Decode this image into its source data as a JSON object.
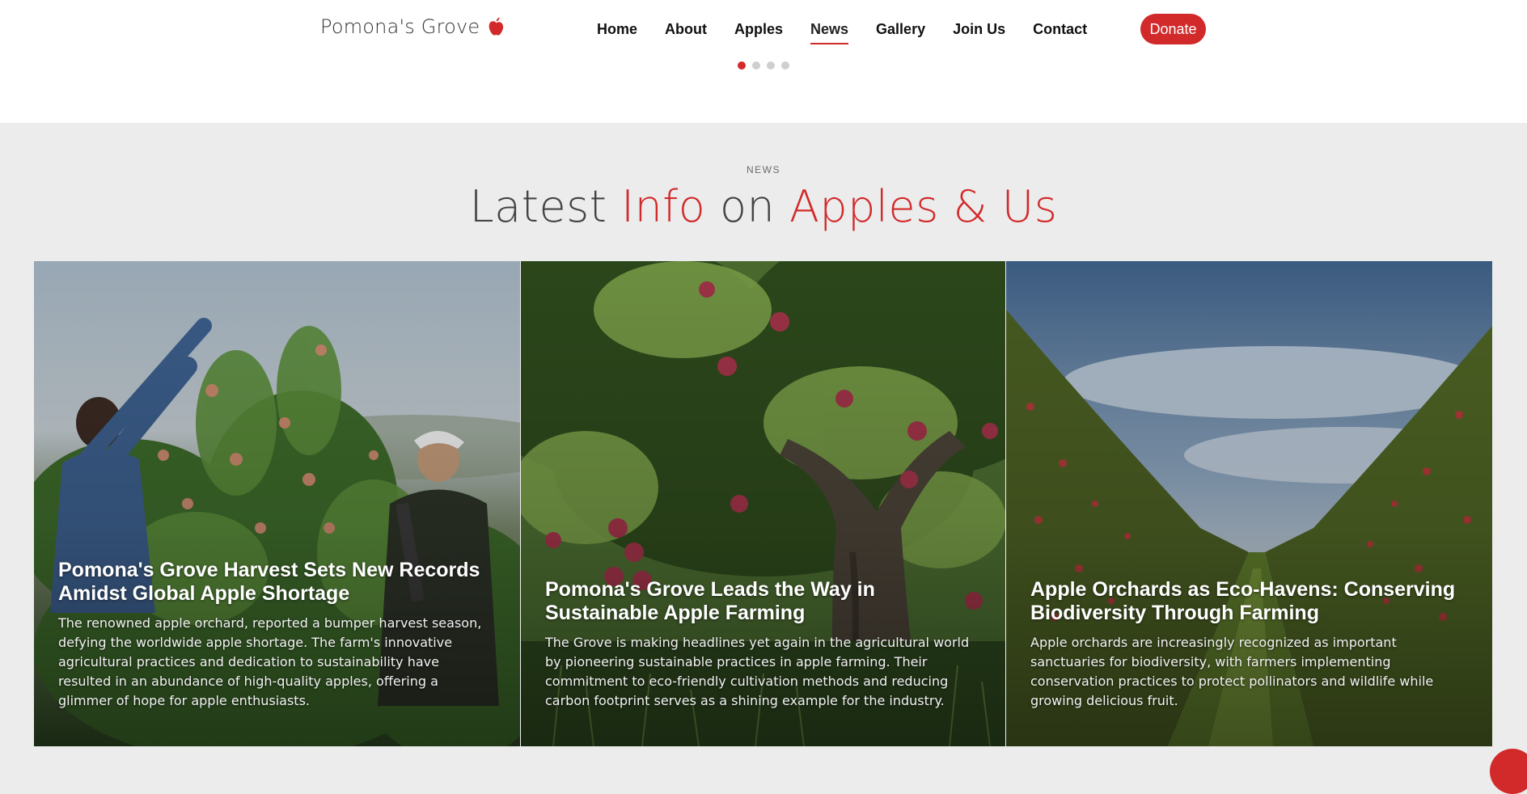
{
  "brand": {
    "name": "Pomona's Grove",
    "logo_icon": "apple-icon",
    "accent": "#d22a2a"
  },
  "nav": {
    "items": [
      {
        "label": "Home"
      },
      {
        "label": "About"
      },
      {
        "label": "Apples"
      },
      {
        "label": "News",
        "active": true
      },
      {
        "label": "Gallery"
      },
      {
        "label": "Join Us"
      },
      {
        "label": "Contact"
      }
    ],
    "donate_label": "Donate"
  },
  "carousel": {
    "dot_count": 4,
    "active_dot": 1
  },
  "section": {
    "eyebrow": "NEWS",
    "heading": {
      "part1": "Latest ",
      "part2": "Info",
      "part3": " on ",
      "part4": "Apples & Us"
    }
  },
  "cards": [
    {
      "title": "Pomona's Grove Harvest Sets New Records Amidst Global Apple Shortage",
      "text": "The renowned apple orchard, reported a bumper harvest season, defying the worldwide apple shortage. The farm's innovative agricultural practices and dedication to sustainability have resulted in an abundance of high-quality apples, offering a glimmer of hope for apple enthusiasts."
    },
    {
      "title": "Pomona's Grove Leads the Way in Sustainable Apple Farming",
      "text": "The Grove is making headlines yet again in the agricultural world by pioneering sustainable practices in apple farming. Their commitment to eco-friendly cultivation methods and reducing carbon footprint serves as a shining example for the industry."
    },
    {
      "title": "Apple Orchards as Eco-Havens: Conserving Biodiversity Through Farming",
      "text": "Apple orchards are increasingly recognized as important sanctuaries for biodiversity, with farmers implementing conservation practices to protect pollinators and wildlife while growing delicious fruit."
    }
  ]
}
